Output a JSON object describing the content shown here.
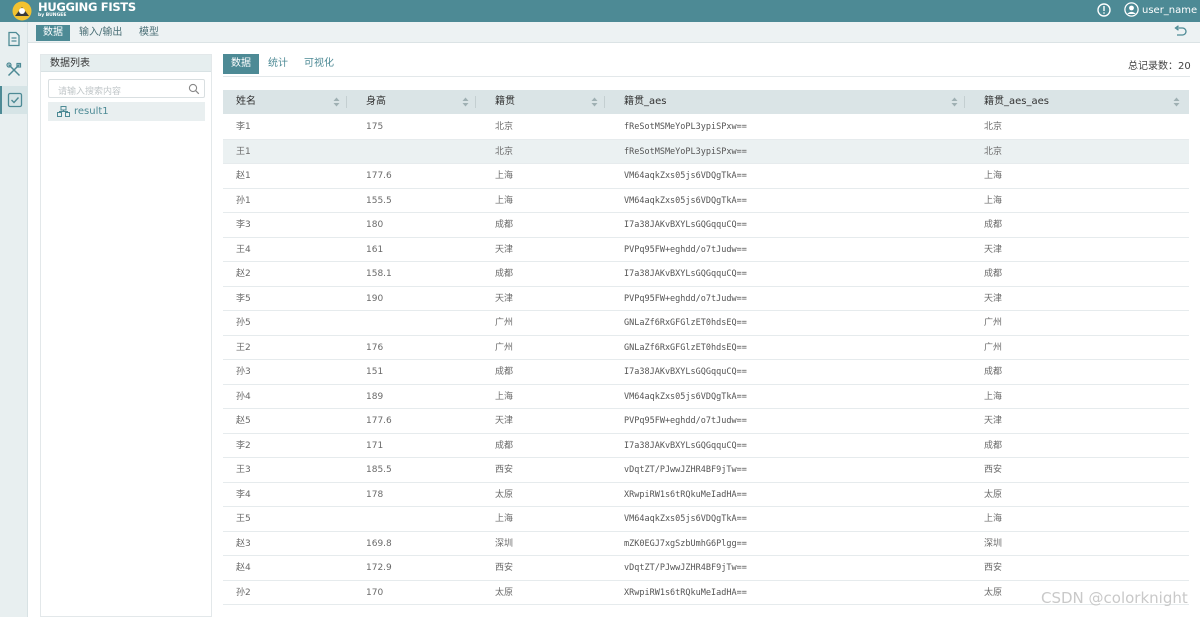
{
  "app": {
    "brand": "HUGGING FISTS",
    "brand_sub": "by BUNGEE",
    "user_name": "user_name"
  },
  "rail": {
    "icons": [
      "document-icon",
      "tools-icon",
      "checkbox-icon"
    ]
  },
  "main_tabs": [
    {
      "label": "数据",
      "active": true
    },
    {
      "label": "输入/输出",
      "active": false
    },
    {
      "label": "模型",
      "active": false
    }
  ],
  "data_list": {
    "title": "数据列表",
    "search_placeholder": "请输入搜索内容",
    "items": [
      {
        "label": "result1"
      }
    ]
  },
  "sub_tabs": [
    {
      "label": "数据",
      "active": true
    },
    {
      "label": "统计",
      "active": false
    },
    {
      "label": "可视化",
      "active": false
    }
  ],
  "total_label": "总记录数：20",
  "table": {
    "columns": [
      "姓名",
      "身高",
      "籍贯",
      "籍贯_aes",
      "籍贯_aes_aes"
    ],
    "rows": [
      [
        "李1",
        "175",
        "北京",
        "fReSotMSMeYoPL3ypiSPxw==",
        "北京"
      ],
      [
        "王1",
        "",
        "北京",
        "fReSotMSMeYoPL3ypiSPxw==",
        "北京"
      ],
      [
        "赵1",
        "177.6",
        "上海",
        "VM64aqkZxs05js6VDQgTkA==",
        "上海"
      ],
      [
        "孙1",
        "155.5",
        "上海",
        "VM64aqkZxs05js6VDQgTkA==",
        "上海"
      ],
      [
        "李3",
        "180",
        "成都",
        "I7a38JAKvBXYLsGQGqquCQ==",
        "成都"
      ],
      [
        "王4",
        "161",
        "天津",
        "PVPq95FW+eghdd/o7tJudw==",
        "天津"
      ],
      [
        "赵2",
        "158.1",
        "成都",
        "I7a38JAKvBXYLsGQGqquCQ==",
        "成都"
      ],
      [
        "李5",
        "190",
        "天津",
        "PVPq95FW+eghdd/o7tJudw==",
        "天津"
      ],
      [
        "孙5",
        "",
        "广州",
        "GNLaZf6RxGFGlzET0hdsEQ==",
        "广州"
      ],
      [
        "王2",
        "176",
        "广州",
        "GNLaZf6RxGFGlzET0hdsEQ==",
        "广州"
      ],
      [
        "孙3",
        "151",
        "成都",
        "I7a38JAKvBXYLsGQGqquCQ==",
        "成都"
      ],
      [
        "孙4",
        "189",
        "上海",
        "VM64aqkZxs05js6VDQgTkA==",
        "上海"
      ],
      [
        "赵5",
        "177.6",
        "天津",
        "PVPq95FW+eghdd/o7tJudw==",
        "天津"
      ],
      [
        "李2",
        "171",
        "成都",
        "I7a38JAKvBXYLsGQGqquCQ==",
        "成都"
      ],
      [
        "王3",
        "185.5",
        "西安",
        "vDqtZT/PJwwJZHR4BF9jTw==",
        "西安"
      ],
      [
        "李4",
        "178",
        "太原",
        "XRwpiRW1s6tRQkuMeIadHA==",
        "太原"
      ],
      [
        "王5",
        "",
        "上海",
        "VM64aqkZxs05js6VDQgTkA==",
        "上海"
      ],
      [
        "赵3",
        "169.8",
        "深圳",
        "mZK0EGJ7xgSzbUmhG6Plgg==",
        "深圳"
      ],
      [
        "赵4",
        "172.9",
        "西安",
        "vDqtZT/PJwwJZHR4BF9jTw==",
        "西安"
      ],
      [
        "孙2",
        "170",
        "太原",
        "XRwpiRW1s6tRQkuMeIadHA==",
        "太原"
      ]
    ],
    "highlighted_row": 1
  },
  "watermark": "CSDN @colorknight",
  "colors": {
    "primary": "#4d8a95",
    "header_bg": "#dae4e6",
    "row_highlight": "#ebf1f2"
  }
}
